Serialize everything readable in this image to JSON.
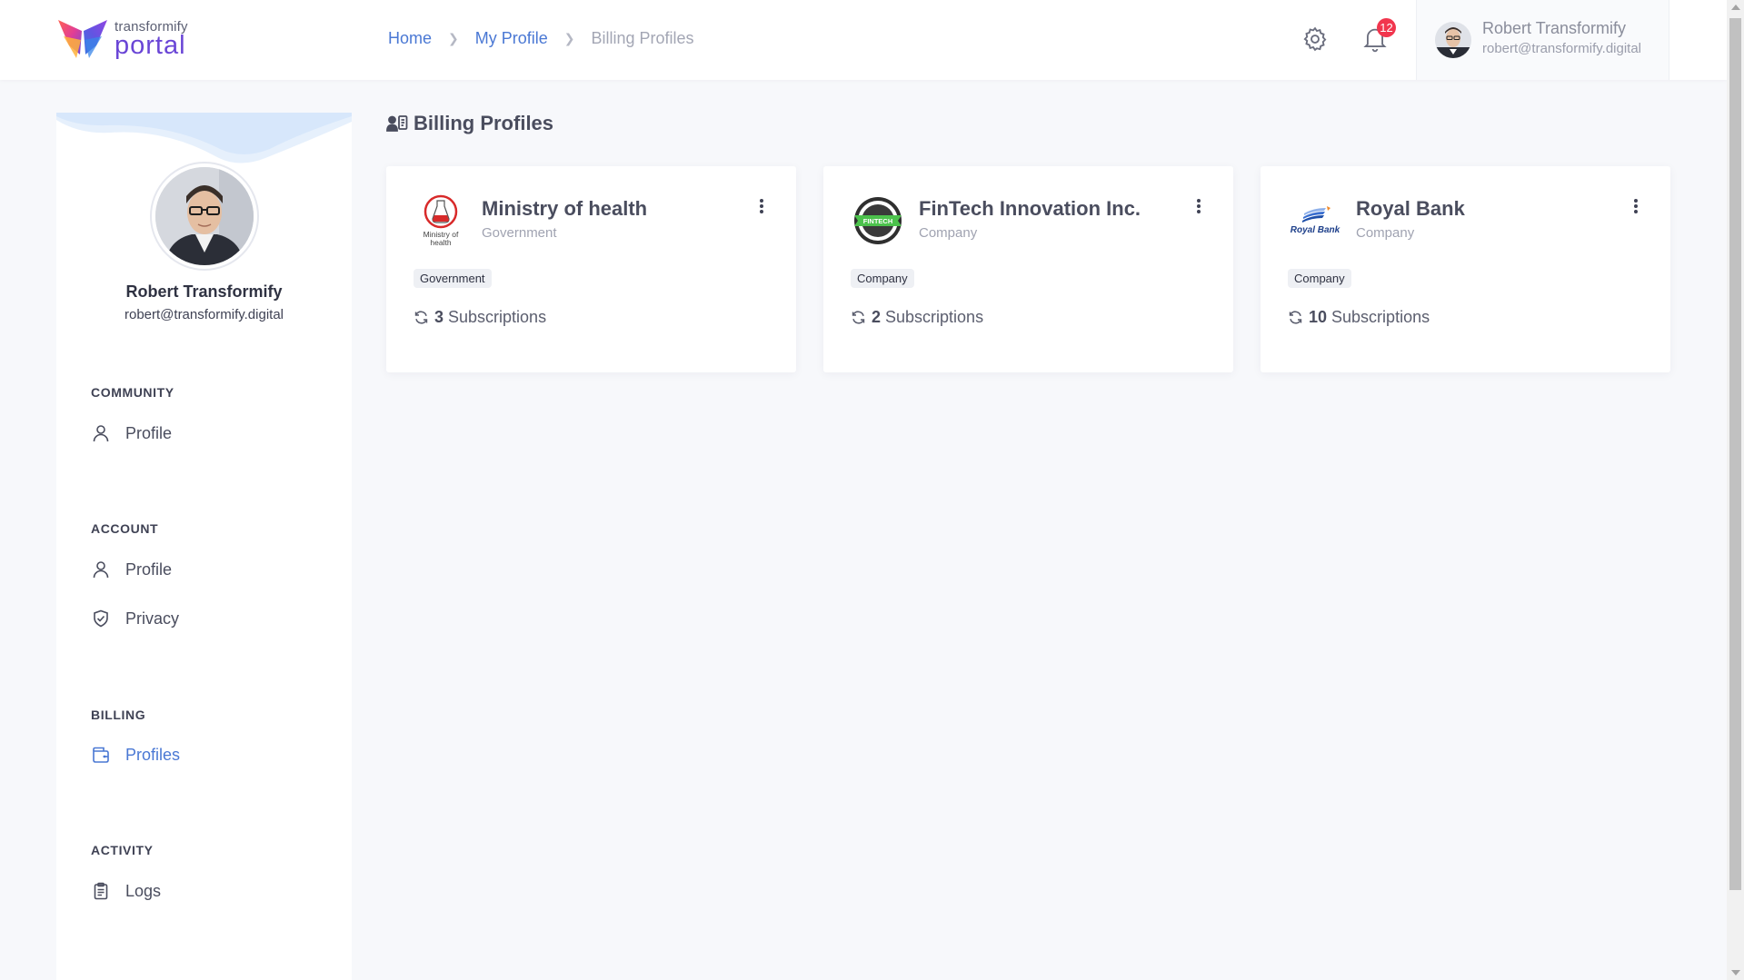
{
  "brand": {
    "small": "transformify",
    "big": "portal"
  },
  "breadcrumb": {
    "home": "Home",
    "my_profile": "My Profile",
    "current": "Billing Profiles"
  },
  "header": {
    "settings_icon": "gear-icon",
    "notifications_icon": "bell-icon",
    "notification_count": "12",
    "user_name": "Robert Transformify",
    "user_email": "robert@transformify.digital"
  },
  "sidebar": {
    "name": "Robert Transformify",
    "email": "robert@transformify.digital",
    "sections": {
      "community": {
        "title": "COMMUNITY",
        "items": [
          {
            "label": "Profile",
            "icon": "user-icon"
          }
        ]
      },
      "account": {
        "title": "ACCOUNT",
        "items": [
          {
            "label": "Profile",
            "icon": "user-icon"
          },
          {
            "label": "Privacy",
            "icon": "shield-check-icon"
          }
        ]
      },
      "billing": {
        "title": "BILLING",
        "items": [
          {
            "label": "Profiles",
            "icon": "wallet-icon",
            "active": true
          }
        ]
      },
      "activity": {
        "title": "ACTIVITY",
        "items": [
          {
            "label": "Logs",
            "icon": "clipboard-icon"
          }
        ]
      }
    }
  },
  "main": {
    "title": "Billing Profiles",
    "title_icon": "user-card-icon",
    "cards": [
      {
        "name": "Ministry of health",
        "type": "Government",
        "tag": "Government",
        "subscriptions_count": "3",
        "subscriptions_label": "Subscriptions",
        "logo": "ministry-of-health-logo",
        "logo_text_1": "Ministry of",
        "logo_text_2": "health"
      },
      {
        "name": "FinTech Innovation Inc.",
        "type": "Company",
        "tag": "Company",
        "subscriptions_count": "2",
        "subscriptions_label": "Subscriptions",
        "logo": "fintech-logo",
        "logo_text_1": "FINTECH"
      },
      {
        "name": "Royal Bank",
        "type": "Company",
        "tag": "Company",
        "subscriptions_count": "10",
        "subscriptions_label": "Subscriptions",
        "logo": "royal-bank-logo",
        "logo_text_1": "Royal Bank"
      }
    ]
  },
  "colors": {
    "accent": "#4a78d4",
    "brand_purple": "#6a46d6",
    "badge_red": "#f1364e",
    "background": "#f7f8fb"
  }
}
